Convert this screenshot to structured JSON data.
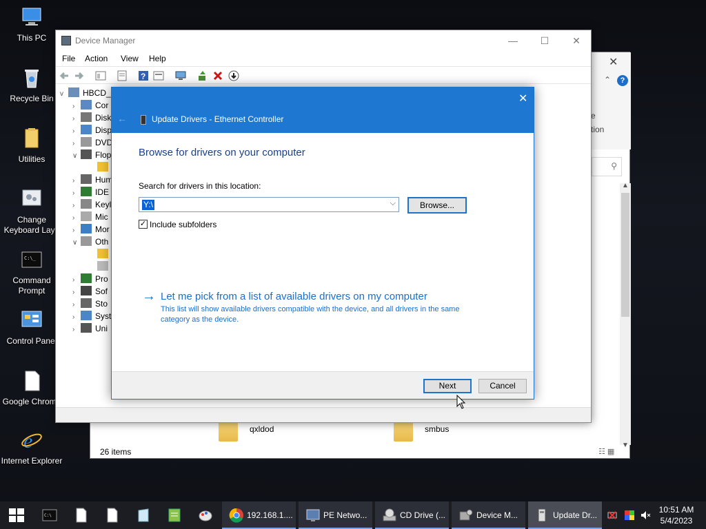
{
  "desktop": {
    "icons": [
      {
        "label": "This PC",
        "icon": "this-pc-icon"
      },
      {
        "label": "Recycle Bin",
        "icon": "recycle-bin-icon"
      },
      {
        "label": "Utilities",
        "icon": "folder-icon"
      },
      {
        "label": "Change Keyboard Layo",
        "icon": "keyboard-settings-icon"
      },
      {
        "label": "Command Prompt",
        "icon": "command-prompt-icon"
      },
      {
        "label": "Control Panel",
        "icon": "control-panel-icon"
      },
      {
        "label": "Google Chrome",
        "icon": "file-icon"
      },
      {
        "label": "Internet Explorer",
        "icon": "internet-explorer-icon"
      }
    ]
  },
  "explorer": {
    "partial_text_1": "e",
    "partial_text_2": "tion",
    "folders": [
      {
        "label": "qxldod"
      },
      {
        "label": "smbus"
      }
    ],
    "status": "26 items"
  },
  "device_manager": {
    "title": "Device Manager",
    "menu": [
      "File",
      "Action",
      "View",
      "Help"
    ],
    "tree": {
      "root": "HBCD_",
      "rows": [
        {
          "text": "Cor",
          "expand": ">",
          "icon": "computer-icon"
        },
        {
          "text": "Disk",
          "expand": ">",
          "icon": "disk-drive-icon"
        },
        {
          "text": "Disp",
          "expand": ">",
          "icon": "display-adapter-icon"
        },
        {
          "text": "DVD",
          "expand": ">",
          "icon": "dvd-drive-icon"
        },
        {
          "text": "Flop",
          "expand": "v",
          "icon": "floppy-icon"
        },
        {
          "text": "",
          "expand": "",
          "icon": "warning-device-icon"
        },
        {
          "text": "Hum",
          "expand": ">",
          "icon": "hid-icon"
        },
        {
          "text": "IDE",
          "expand": ">",
          "icon": "ide-controller-icon"
        },
        {
          "text": "Keyl",
          "expand": ">",
          "icon": "keyboard-icon"
        },
        {
          "text": "Mic",
          "expand": ">",
          "icon": "mouse-icon"
        },
        {
          "text": "Mor",
          "expand": ">",
          "icon": "monitor-icon"
        },
        {
          "text": "Oth",
          "expand": "v",
          "icon": "other-devices-icon"
        },
        {
          "text": "",
          "expand": "",
          "icon": "warning-device-icon"
        },
        {
          "text": "",
          "expand": "",
          "icon": "unknown-device-icon"
        },
        {
          "text": "Pro",
          "expand": ">",
          "icon": "processor-icon"
        },
        {
          "text": "Sof",
          "expand": ">",
          "icon": "software-device-icon"
        },
        {
          "text": "Sto",
          "expand": ">",
          "icon": "storage-controller-icon"
        },
        {
          "text": "Syst",
          "expand": ">",
          "icon": "system-devices-icon"
        },
        {
          "text": "Uni",
          "expand": ">",
          "icon": "usb-icon"
        }
      ]
    }
  },
  "dialog": {
    "title": "Update Drivers - Ethernet Controller",
    "heading": "Browse for drivers on your computer",
    "search_label": "Search for drivers in this location:",
    "path_value": "Y:\\",
    "browse_label": "Browse...",
    "include_subfolders_label": "Include subfolders",
    "include_subfolders_checked": true,
    "pick_link": "Let me pick from a list of available drivers on my computer",
    "pick_description": "This list will show available drivers compatible with the device, and all drivers in the same category as the device.",
    "next_label": "Next",
    "cancel_label": "Cancel"
  },
  "taskbar": {
    "tasks": [
      {
        "label": "192.168.1....",
        "icon": "chrome-icon"
      },
      {
        "label": "PE Netwo...",
        "icon": "network-tool-icon"
      },
      {
        "label": "CD Drive (...",
        "icon": "cd-drive-icon"
      },
      {
        "label": "Device M...",
        "icon": "device-manager-icon"
      },
      {
        "label": "Update Dr...",
        "icon": "update-driver-icon"
      }
    ],
    "time": "10:51 AM",
    "date": "5/4/2023"
  },
  "colors": {
    "dialog_header": "#1e78d2",
    "link": "#1c6ec9",
    "heading": "#1a3f8a",
    "taskbar": "#1b1d23"
  }
}
